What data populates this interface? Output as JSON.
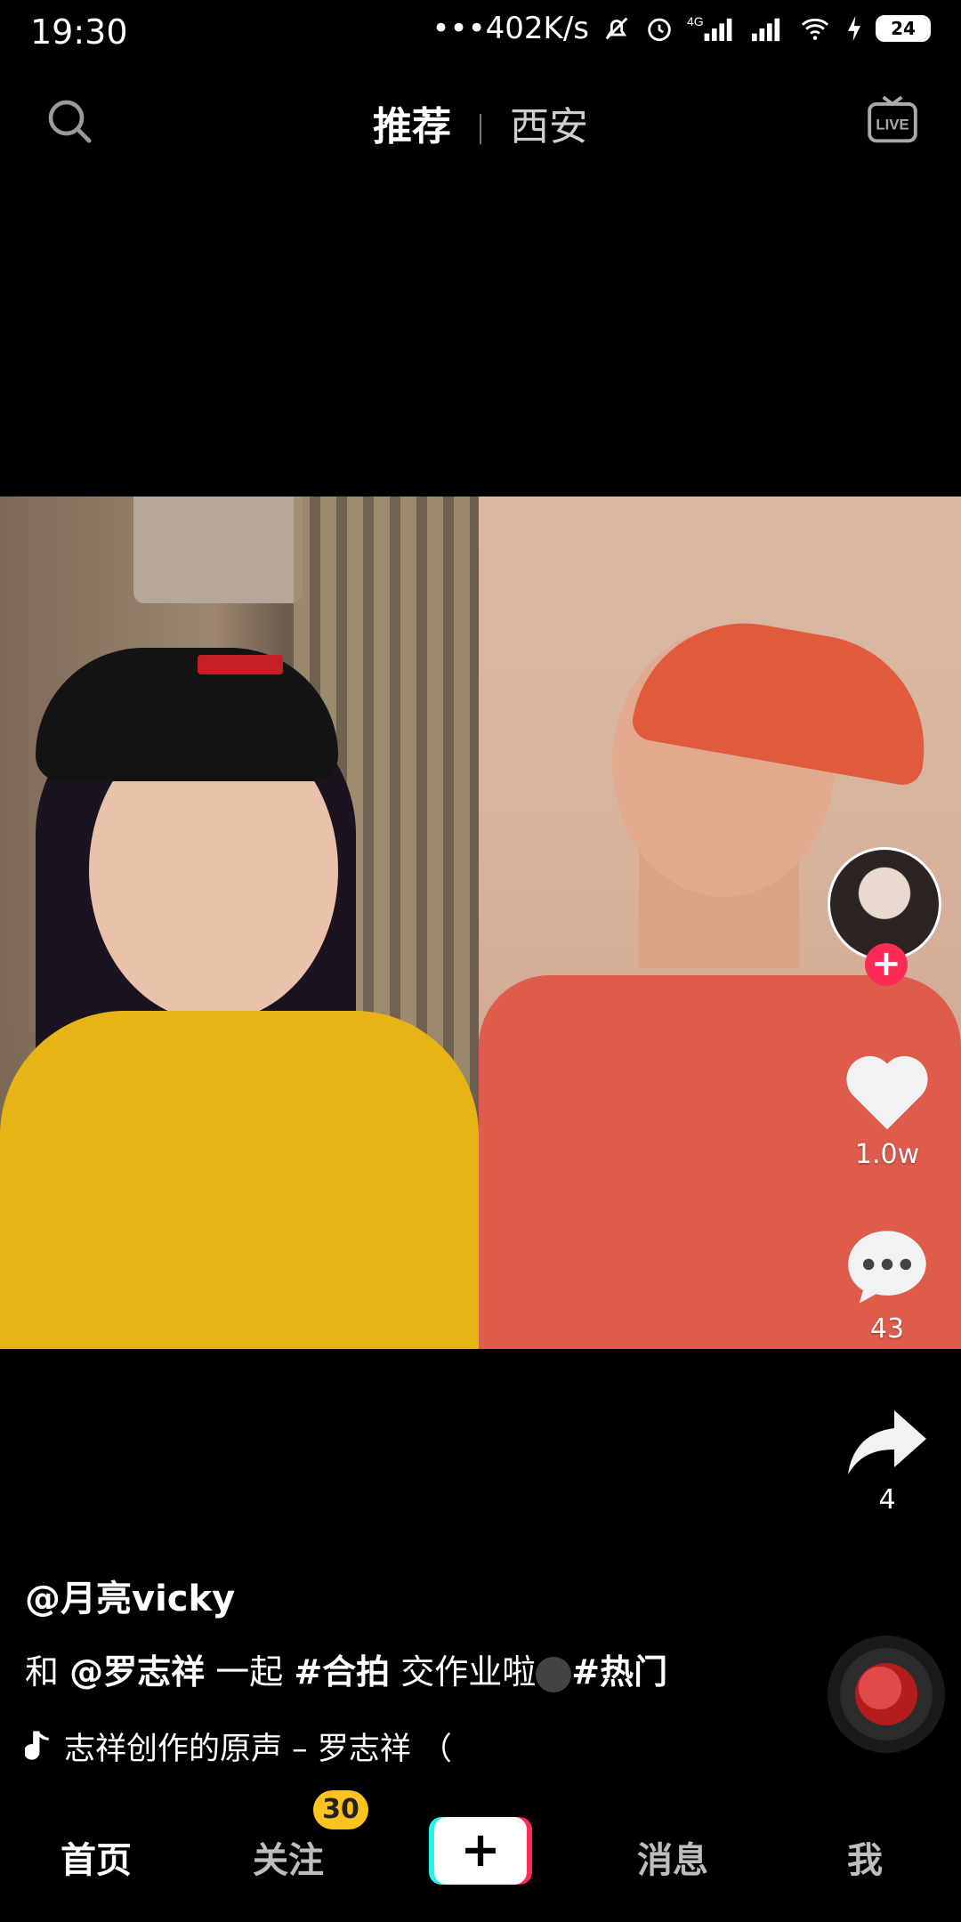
{
  "status_bar": {
    "time": "19:30",
    "network_speed": "•••402K/s",
    "battery": "24",
    "icons": [
      "mute-icon",
      "alarm-icon",
      "signal-4g-icon",
      "signal-icon",
      "wifi-icon",
      "charging-icon",
      "battery-icon"
    ]
  },
  "top_nav": {
    "tabs": [
      {
        "label": "推荐",
        "active": true
      },
      {
        "label": "西安",
        "active": false
      }
    ],
    "live_label": "LIVE"
  },
  "actions": {
    "likes": "1.0w",
    "comments": "43",
    "shares": "4"
  },
  "caption": {
    "username": "@月亮vicky",
    "desc_prefix": "和",
    "mention": "@罗志祥",
    "desc_mid": "一起",
    "hashtag1": "#合拍",
    "desc_text": "交作业啦",
    "hashtag2": "#热门",
    "music": "志祥创作的原声 – 罗志祥 （"
  },
  "bottom_nav": {
    "home": "首页",
    "following": "关注",
    "following_badge": "30",
    "create": "+",
    "messages": "消息",
    "me": "我"
  },
  "colors": {
    "accent_red": "#fe2c55",
    "accent_cyan": "#25f4ee",
    "badge_yellow": "#fcc31e"
  }
}
